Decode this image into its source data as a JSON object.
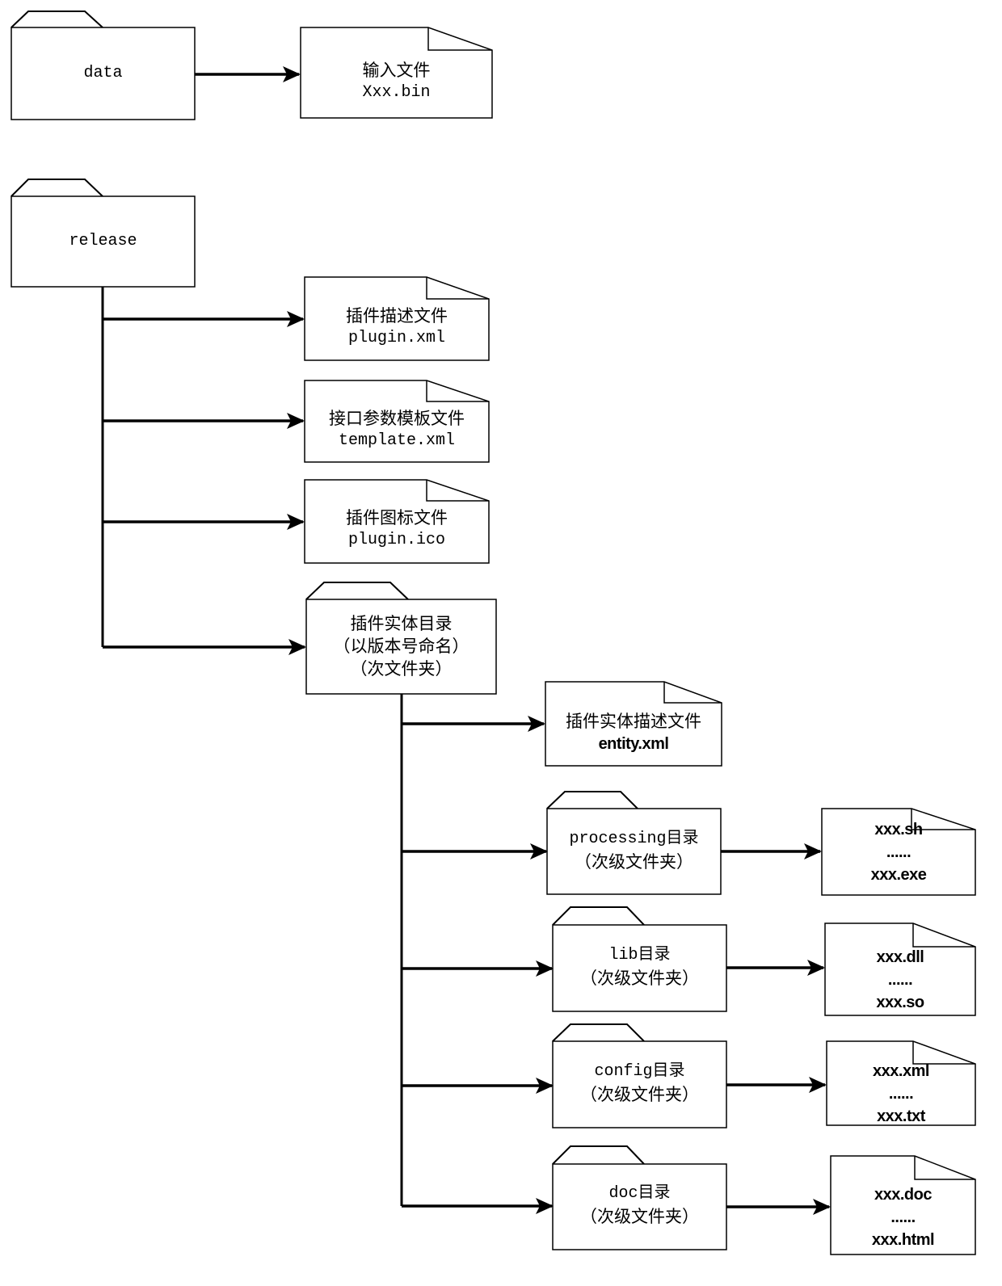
{
  "diagram": {
    "root_folders": [
      {
        "id": "data",
        "label": "data",
        "type": "folder",
        "children": [
          {
            "id": "input-file",
            "type": "file",
            "lines": [
              "输入文件",
              "Xxx.bin"
            ]
          }
        ]
      },
      {
        "id": "release",
        "label": "release",
        "type": "folder",
        "children": [
          {
            "id": "plugin-desc",
            "type": "file",
            "lines": [
              "插件描述文件",
              "plugin.xml"
            ]
          },
          {
            "id": "template",
            "type": "file",
            "lines": [
              "接口参数模板文件",
              "template.xml"
            ]
          },
          {
            "id": "plugin-icon",
            "type": "file",
            "lines": [
              "插件图标文件",
              "plugin.ico"
            ]
          },
          {
            "id": "entity-dir",
            "type": "folder",
            "lines": [
              "插件实体目录",
              "（以版本号命名）",
              "（次文件夹）"
            ],
            "children": [
              {
                "id": "entity-desc",
                "type": "file",
                "lines": [
                  "插件实体描述文件",
                  "entity.xml"
                ]
              },
              {
                "id": "processing",
                "type": "folder",
                "lines": [
                  "processing目录",
                  "（次级文件夹）"
                ],
                "children": [
                  {
                    "id": "processing-files",
                    "type": "file",
                    "lines": [
                      "xxx.sh",
                      "......",
                      "xxx.exe"
                    ]
                  }
                ]
              },
              {
                "id": "lib",
                "type": "folder",
                "lines": [
                  "lib目录",
                  "（次级文件夹）"
                ],
                "children": [
                  {
                    "id": "lib-files",
                    "type": "file",
                    "lines": [
                      "xxx.dll",
                      "......",
                      "xxx.so"
                    ]
                  }
                ]
              },
              {
                "id": "config",
                "type": "folder",
                "lines": [
                  "config目录",
                  "（次级文件夹）"
                ],
                "children": [
                  {
                    "id": "config-files",
                    "type": "file",
                    "lines": [
                      "xxx.xml",
                      "......",
                      "xxx.txt"
                    ]
                  }
                ]
              },
              {
                "id": "doc",
                "type": "folder",
                "lines": [
                  "doc目录",
                  "（次级文件夹）"
                ],
                "children": [
                  {
                    "id": "doc-files",
                    "type": "file",
                    "lines": [
                      "xxx.doc",
                      "......",
                      "xxx.html"
                    ]
                  }
                ]
              }
            ]
          }
        ]
      }
    ]
  },
  "labels": {
    "data": "data",
    "input_file": {
      "l1": "输入文件",
      "l2": "Xxx.bin"
    },
    "release": "release",
    "plugin_desc": {
      "l1": "插件描述文件",
      "l2": "plugin.xml"
    },
    "template": {
      "l1": "接口参数模板文件",
      "l2": "template.xml"
    },
    "plugin_icon": {
      "l1": "插件图标文件",
      "l2": "plugin.ico"
    },
    "entity_dir": {
      "l1": "插件实体目录",
      "l2": "（以版本号命名）",
      "l3": "（次文件夹）"
    },
    "entity_desc": {
      "l1": "插件实体描述文件",
      "l2": "entity.xml"
    },
    "processing": {
      "l1": "processing目录",
      "l2": "（次级文件夹）"
    },
    "processing_files": {
      "l1": "xxx.sh",
      "l2": "......",
      "l3": "xxx.exe"
    },
    "lib": {
      "l1": "lib目录",
      "l2": "（次级文件夹）"
    },
    "lib_files": {
      "l1": "xxx.dll",
      "l2": "......",
      "l3": "xxx.so"
    },
    "config": {
      "l1": "config目录",
      "l2": "（次级文件夹）"
    },
    "config_files": {
      "l1": "xxx.xml",
      "l2": "......",
      "l3": "xxx.txt"
    },
    "doc": {
      "l1": "doc目录",
      "l2": "（次级文件夹）"
    },
    "doc_files": {
      "l1": "xxx.doc",
      "l2": "......",
      "l3": "xxx.html"
    }
  },
  "colors": {
    "stroke": "#000000",
    "background": "#ffffff"
  }
}
